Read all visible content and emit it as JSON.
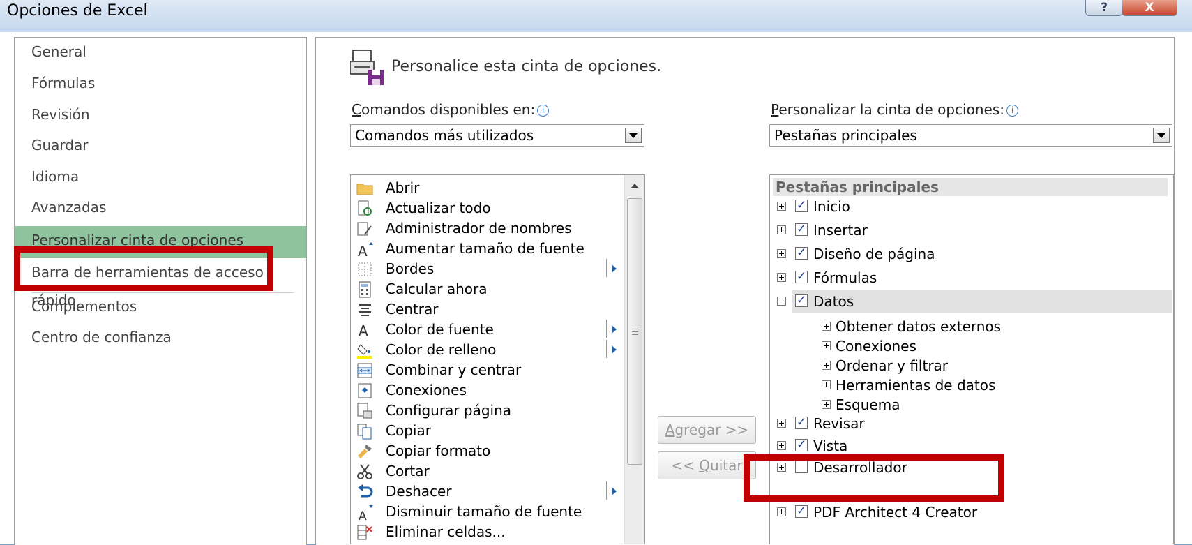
{
  "window": {
    "title": "Opciones de Excel",
    "help_label": "?",
    "close_label": "X"
  },
  "nav": {
    "items": [
      {
        "label": "General"
      },
      {
        "label": "Fórmulas"
      },
      {
        "label": "Revisión"
      },
      {
        "label": "Guardar"
      },
      {
        "label": "Idioma"
      },
      {
        "label": "Avanzadas"
      },
      {
        "label": "Personalizar cinta de opciones",
        "selected": true
      },
      {
        "label": "Barra de herramientas de acceso rápido"
      },
      {
        "label": "Complementos"
      },
      {
        "label": "Centro de confianza"
      }
    ]
  },
  "header": {
    "title": "Personalice esta cinta de opciones."
  },
  "commands": {
    "label_first": "C",
    "label_rest": "omandos disponibles en:",
    "info": "i",
    "selected": "Comandos más utilizados",
    "items": [
      {
        "label": "Abrir",
        "icon": "folder-icon"
      },
      {
        "label": "Actualizar todo",
        "icon": "refresh-icon"
      },
      {
        "label": "Administrador de nombres",
        "icon": "name-manager-icon"
      },
      {
        "label": "Aumentar tamaño de fuente",
        "icon": "increase-font-icon"
      },
      {
        "label": "Bordes",
        "icon": "borders-icon",
        "submenu": true
      },
      {
        "label": "Calcular ahora",
        "icon": "calculator-icon"
      },
      {
        "label": "Centrar",
        "icon": "center-align-icon"
      },
      {
        "label": "Color de fuente",
        "icon": "font-color-icon",
        "submenu": true
      },
      {
        "label": "Color de relleno",
        "icon": "fill-color-icon",
        "submenu": true
      },
      {
        "label": "Combinar y centrar",
        "icon": "merge-center-icon"
      },
      {
        "label": "Conexiones",
        "icon": "connections-icon"
      },
      {
        "label": "Configurar página",
        "icon": "page-setup-icon"
      },
      {
        "label": "Copiar",
        "icon": "copy-icon"
      },
      {
        "label": "Copiar formato",
        "icon": "format-painter-icon"
      },
      {
        "label": "Cortar",
        "icon": "scissors-icon"
      },
      {
        "label": "Deshacer",
        "icon": "undo-icon",
        "submenu": true
      },
      {
        "label": "Disminuir tamaño de fuente",
        "icon": "decrease-font-icon"
      },
      {
        "label": "Eliminar celdas...",
        "icon": "delete-cells-icon"
      }
    ]
  },
  "ribbon": {
    "label_first": "P",
    "label_rest": "ersonalizar la cinta de opciones:",
    "info": "i",
    "selected": "Pestañas principales",
    "tree_header": "Pestañas principales",
    "tabs": [
      {
        "label": "Inicio",
        "checked": true,
        "expanded": false
      },
      {
        "label": "Insertar",
        "checked": true,
        "expanded": false
      },
      {
        "label": "Diseño de página",
        "checked": true,
        "expanded": false
      },
      {
        "label": "Fórmulas",
        "checked": true,
        "expanded": false
      },
      {
        "label": "Datos",
        "checked": true,
        "expanded": true,
        "selected": true
      },
      {
        "label": "Revisar",
        "checked": true,
        "expanded": false
      },
      {
        "label": "Vista",
        "checked": true,
        "expanded": false
      },
      {
        "label": "Desarrollador",
        "checked": false,
        "expanded": false
      },
      {
        "label": "PDF Architect 4 Creator",
        "checked": true,
        "expanded": false
      }
    ],
    "datos_groups": [
      "Obtener datos externos",
      "Conexiones",
      "Ordenar y filtrar",
      "Herramientas de datos",
      "Esquema"
    ]
  },
  "buttons": {
    "add_first": "A",
    "add_rest": "gregar >>",
    "remove_prefix": "<< ",
    "remove_first": "Q",
    "remove_rest": "uitar"
  },
  "colors": {
    "highlight_red": "#c00000",
    "nav_selected": "#8fc39d"
  }
}
